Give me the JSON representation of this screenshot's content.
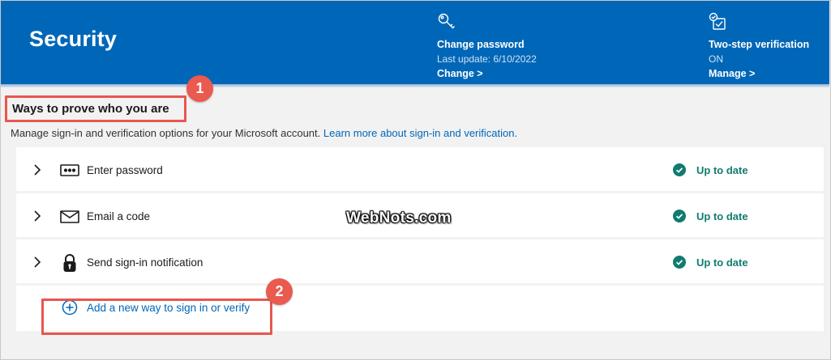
{
  "header": {
    "title": "Security",
    "password": {
      "title": "Change password",
      "subtitle": "Last update: 6/10/2022",
      "link": "Change >",
      "icon": "key-icon"
    },
    "two_step": {
      "title": "Two-step verification",
      "subtitle": "ON",
      "link": "Manage >",
      "icon": "checklist-icon"
    },
    "bg_color": "#0067b8"
  },
  "section": {
    "heading": "Ways to prove who you are",
    "description": "Manage sign-in and verification options for your Microsoft account.",
    "learn_more": "Learn more about sign-in and verification."
  },
  "methods": [
    {
      "label": "Enter password",
      "icon": "password-dots-icon",
      "status": "Up to date"
    },
    {
      "label": "Email a code",
      "icon": "envelope-icon",
      "status": "Up to date"
    },
    {
      "label": "Send sign-in notification",
      "icon": "lock-icon",
      "status": "Up to date"
    }
  ],
  "add_method": {
    "label": "Add a new way to sign in or verify",
    "icon": "plus-circle-icon"
  },
  "callouts": {
    "one": "1",
    "two": "2",
    "color": "#ea5a4e"
  },
  "watermark": "WebNots.com",
  "status_color": "#107c6f",
  "link_color": "#0067b8"
}
